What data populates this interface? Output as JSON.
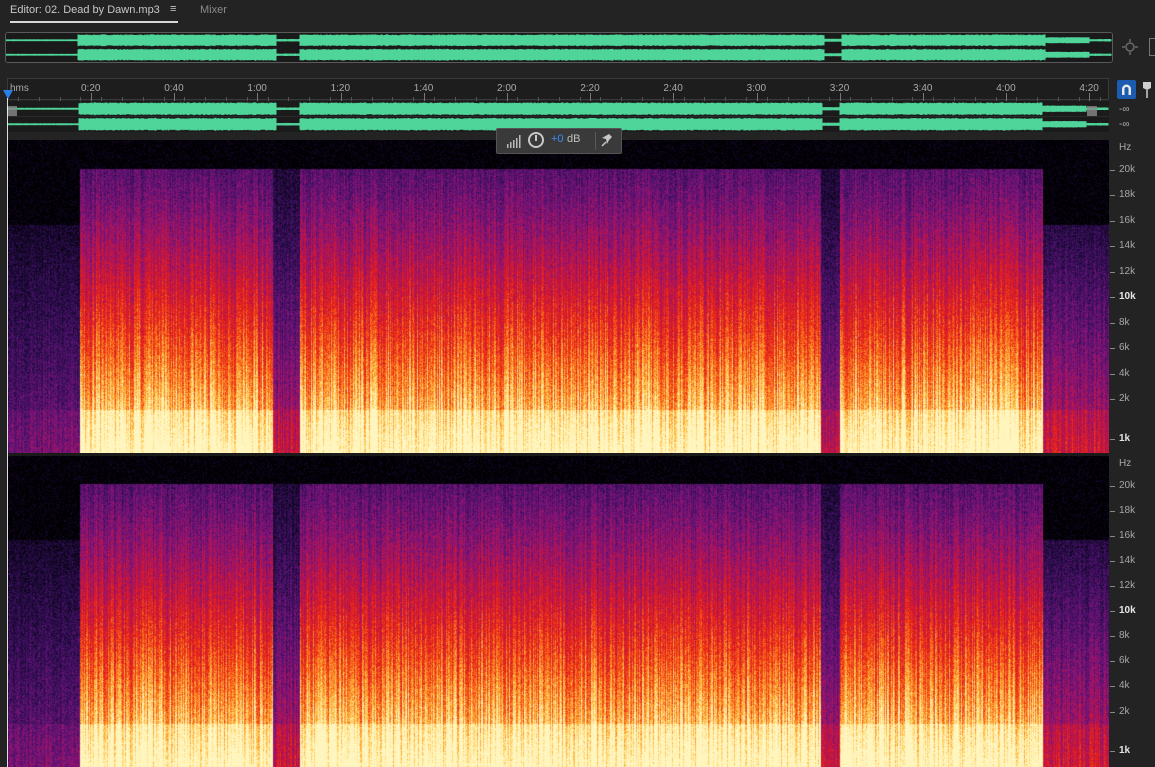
{
  "tabs": {
    "editor_label": "Editor: 02. Dead by Dawn.mp3",
    "menu_glyph": "≡",
    "mixer_label": "Mixer"
  },
  "ruler": {
    "units_label": "hms",
    "ticks": [
      "0:20",
      "0:40",
      "1:00",
      "1:20",
      "1:40",
      "2:00",
      "2:20",
      "2:40",
      "3:00",
      "3:20",
      "3:40",
      "4:00",
      "4:20"
    ]
  },
  "channels": {
    "left_level": "-∞",
    "right_level": "-∞"
  },
  "hud": {
    "value": "+0",
    "unit": "dB"
  },
  "spectral": {
    "unit_label": "Hz",
    "labels": [
      "20k",
      "18k",
      "16k",
      "14k",
      "12k",
      "10k",
      "8k",
      "6k",
      "4k",
      "2k",
      "1k"
    ]
  },
  "colors": {
    "waveform": "#4fd49a",
    "playhead": "#2b7fe8",
    "hud_value": "#3a8ef6",
    "snap_button": "#1c5cb0"
  },
  "icons": [
    "zoom-navigator-icon",
    "snap-magnet-icon",
    "marker-pin-icon",
    "level-meter-icon",
    "volume-knob-icon",
    "pin-icon"
  ]
}
